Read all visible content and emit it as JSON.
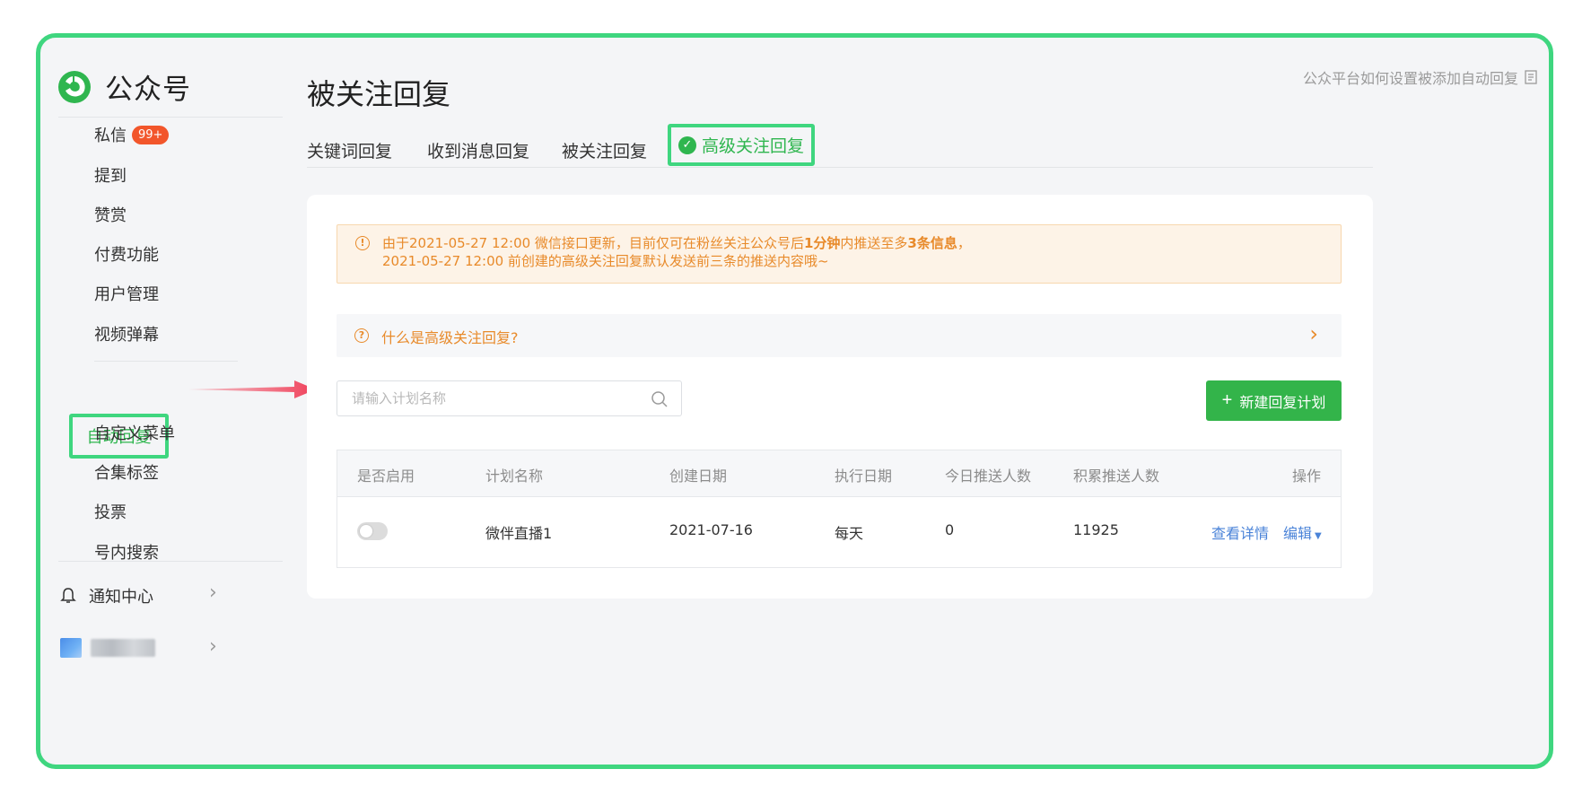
{
  "app": {
    "name": "公众号"
  },
  "sidebar": {
    "items": [
      {
        "label": "私信",
        "badge": "99+"
      },
      {
        "label": "提到"
      },
      {
        "label": "赞赏"
      },
      {
        "label": "付费功能"
      },
      {
        "label": "用户管理"
      },
      {
        "label": "视频弹幕"
      },
      {
        "label": "自动回复",
        "active": true
      },
      {
        "label": "自定义菜单"
      },
      {
        "label": "合集标签"
      },
      {
        "label": "投票"
      },
      {
        "label": "号内搜索"
      }
    ],
    "notification_center": "通知中心"
  },
  "header": {
    "title": "被关注回复",
    "help_link": "公众平台如何设置被添加自动回复"
  },
  "tabs": [
    {
      "label": "关键词回复"
    },
    {
      "label": "收到消息回复"
    },
    {
      "label": "被关注回复"
    },
    {
      "label": "高级关注回复",
      "active": true
    }
  ],
  "notice": {
    "line1_a": "由于2021-05-27 12:00 微信接口更新，目前仅可在粉丝关注公众号后",
    "line1_b": "1分钟",
    "line1_c": "内推送至多",
    "line1_d": "3条信息",
    "line1_e": "，",
    "line2": "2021-05-27 12:00 前创建的高级关注回复默认发送前三条的推送内容哦~"
  },
  "faq": {
    "label": "什么是高级关注回复?"
  },
  "search": {
    "placeholder": "请输入计划名称",
    "value": ""
  },
  "new_plan_button": {
    "label": "新建回复计划"
  },
  "table": {
    "headers": [
      "是否启用",
      "计划名称",
      "创建日期",
      "执行日期",
      "今日推送人数",
      "积累推送人数",
      "操作"
    ],
    "rows": [
      {
        "enabled": false,
        "name": "微伴直播1",
        "created": "2021-07-16",
        "schedule": "每天",
        "today": "0",
        "total": "11925",
        "actions": [
          "查看详情",
          "编辑"
        ]
      }
    ]
  },
  "colors": {
    "accent_green": "#33b44a",
    "highlight_border": "#3fd67f",
    "warning_orange": "#e88a2a",
    "link_blue": "#4a83d8",
    "badge_red": "#f2562b"
  }
}
